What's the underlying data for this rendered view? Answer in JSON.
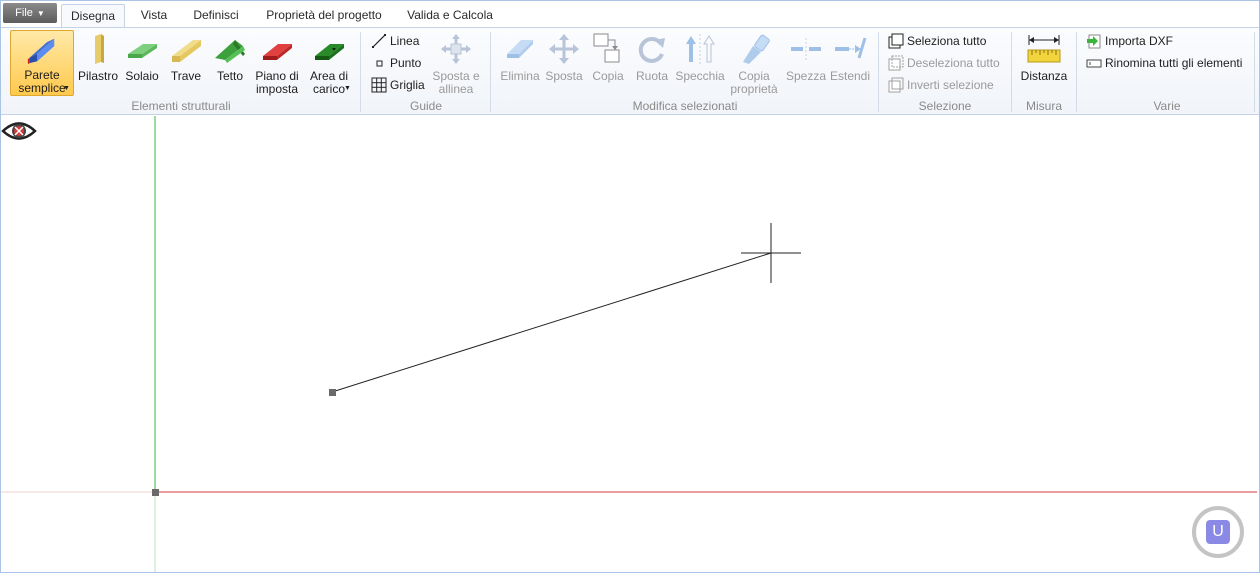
{
  "file_menu": {
    "label": "File"
  },
  "tabs": [
    {
      "label": "Disegna",
      "active": true
    },
    {
      "label": "Vista"
    },
    {
      "label": "Definisci"
    },
    {
      "label": "Proprietà del progetto"
    },
    {
      "label": "Valida e Calcola"
    }
  ],
  "groups": {
    "structural": {
      "label": "Elementi strutturali",
      "buttons": {
        "parete": "Parete\nsemplice",
        "pilastro": "Pilastro",
        "solaio": "Solaio",
        "trave": "Trave",
        "tetto": "Tetto",
        "piano": "Piano di\nimposta",
        "area": "Area di\ncarico"
      }
    },
    "guides": {
      "label": "Guide",
      "linea": "Linea",
      "punto": "Punto",
      "griglia": "Griglia",
      "sposta_allinea": "Sposta e\nallinea"
    },
    "modify": {
      "label": "Modifica selezionati",
      "elimina": "Elimina",
      "sposta": "Sposta",
      "copia": "Copia",
      "ruota": "Ruota",
      "specchia": "Specchia",
      "copia_proprieta": "Copia\nproprietà",
      "spezza": "Spezza",
      "estendi": "Estendi"
    },
    "selection": {
      "label": "Selezione",
      "seleziona_tutto": "Seleziona tutto",
      "deseleziona_tutto": "Deseleziona tutto",
      "inverti": "Inverti selezione"
    },
    "measure": {
      "label": "Misura",
      "distanza": "Distanza"
    },
    "misc": {
      "label": "Varie",
      "importa_dxf": "Importa DXF",
      "rinomina": "Rinomina tutti gli elementi"
    }
  },
  "canvas": {
    "corner_badge": "U",
    "colors": {
      "y_axis": "#3cb43c",
      "x_axis": "#d23c3c",
      "line": "#222222"
    }
  },
  "colors": {
    "accent": "#ffc94d",
    "ribbon_border": "#c4d3e6"
  }
}
